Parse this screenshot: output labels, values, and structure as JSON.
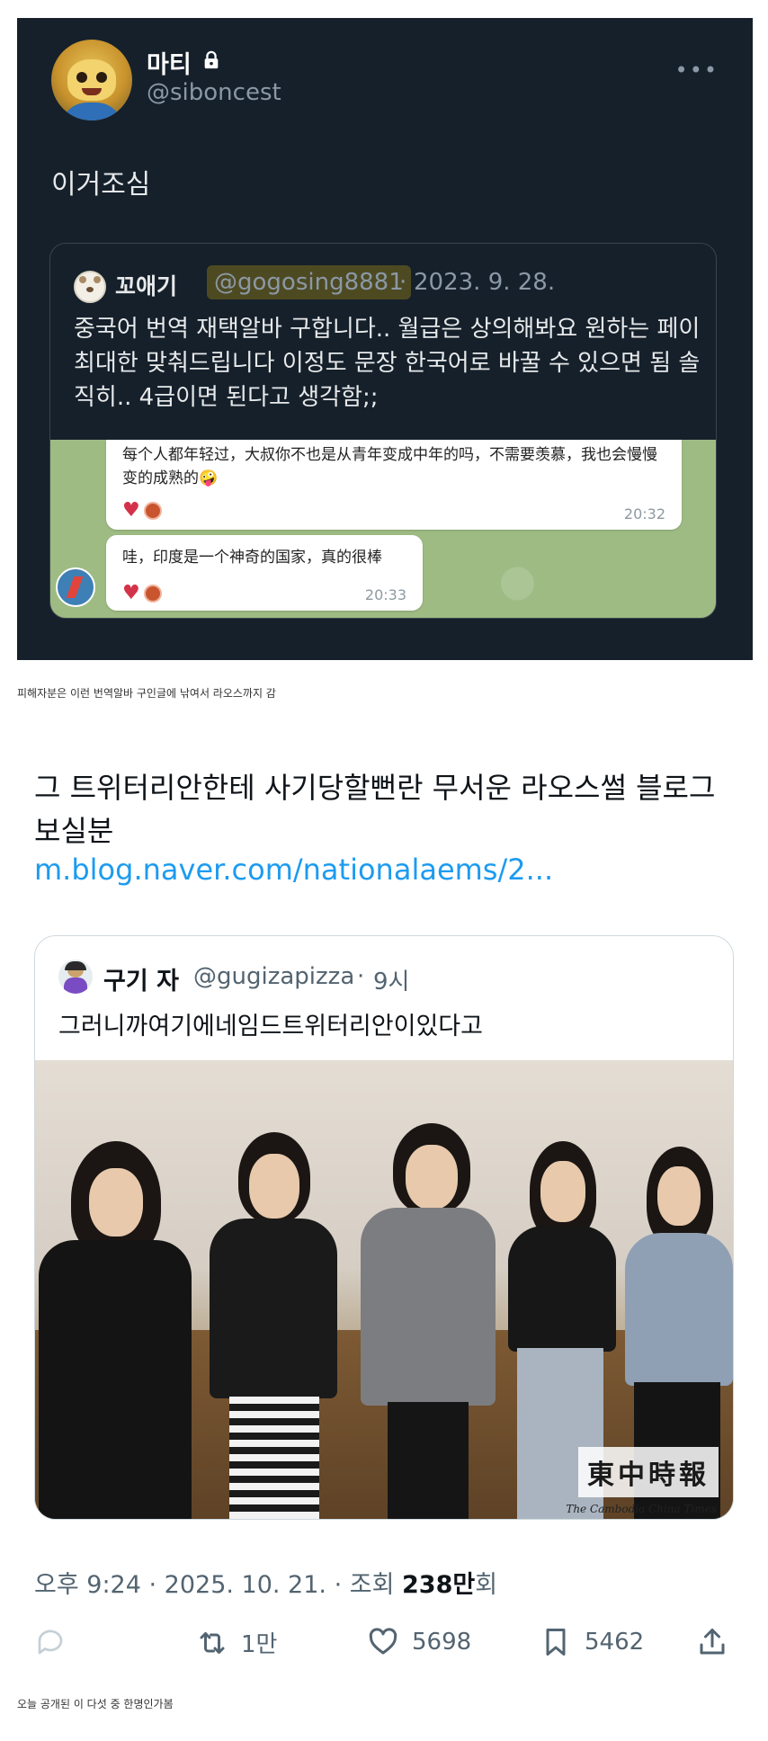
{
  "top_tweet": {
    "display_name": "마티",
    "handle": "@siboncest",
    "text": "이거조심",
    "quoted": {
      "display_name": "꼬애기",
      "handle": "@gogosing8881",
      "separator": "·",
      "date": "2023. 9. 28.",
      "text": "중국어 번역 재택알바 구합니다.. 월급은 상의해봐요 원하는 페이 최대한 맞춰드립니다 이정도 문장 한국어로 바꿀 수 있으면 됨 솔직히.. 4급이면 된다고 생각함;;",
      "chat": {
        "message1": "每个人都年轻过，大叔你不也是从青年变成中年的吗，不需要羡慕，我也会慢慢变的成熟的🤪",
        "time1": "20:32",
        "message2": "哇，印度是一个神奇的国家，真的很棒",
        "time2": "20:33"
      }
    }
  },
  "caption1": "피해자분은 이런 번역알바 구인글에 낚여서 라오스까지 감",
  "main_tweet": {
    "text": "그 트위터리안한테 사기당할뻔란 무서운 라오스썰 블로그 보실분",
    "link": "m.blog.naver.com/nationalaems/2...",
    "quoted": {
      "display_name": "구기 자",
      "handle": "@gugizapizza",
      "separator": "·",
      "time": "9시",
      "text": "그러니까여기에네임드트위터리안이있다고",
      "watermark": "東中時報",
      "watermark_sub": "The Cambodia China Times"
    },
    "meta": {
      "time": "오후 9:24",
      "dot1": " · ",
      "date": "2025. 10. 21.",
      "dot2": " · ",
      "views_label": "조회 ",
      "views_count": "238만",
      "views_suffix": "회"
    },
    "actions": {
      "retweets": "1만",
      "likes": "5698",
      "bookmarks": "5462"
    }
  },
  "caption2": "오늘 공개된 이 다섯 중 한명인가봄",
  "colors": {
    "dark_bg": "#15202b",
    "link": "#1d9bf0",
    "secondary": "#536471"
  }
}
